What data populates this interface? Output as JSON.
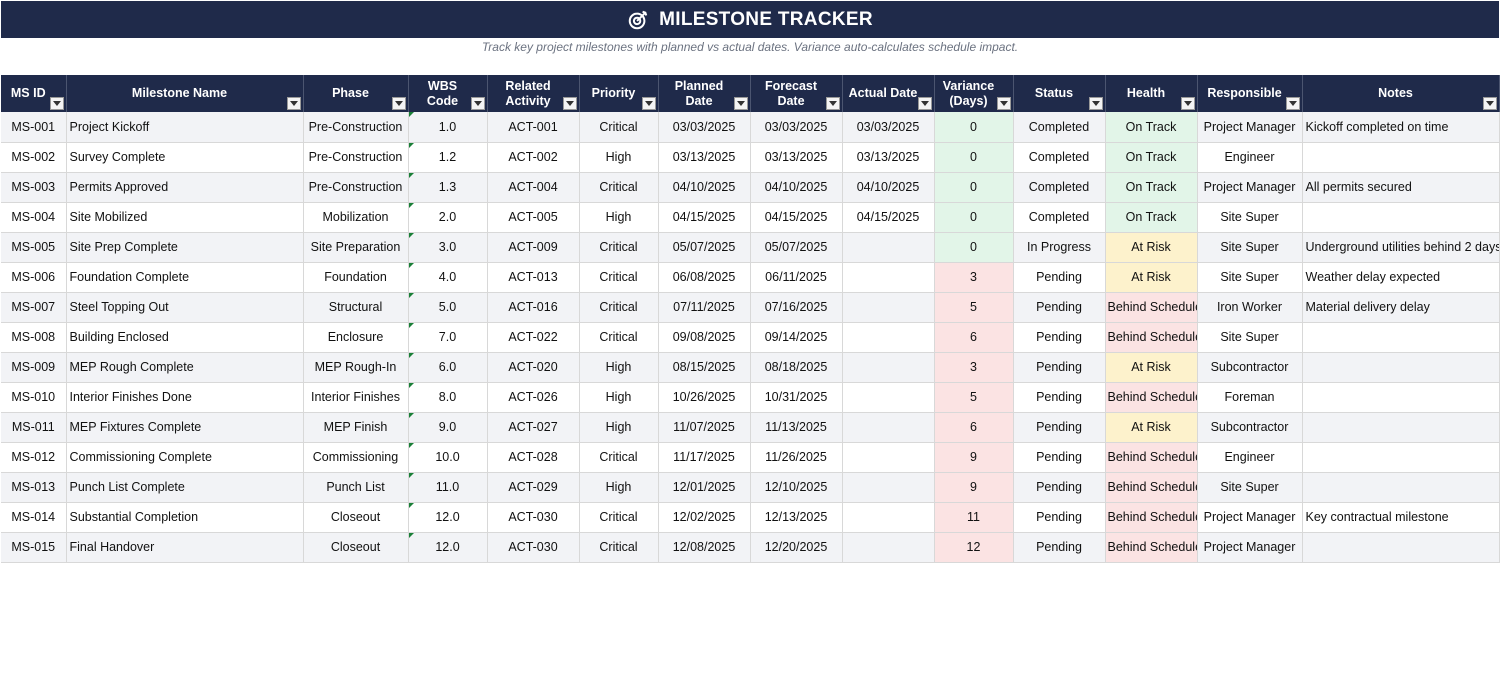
{
  "header": {
    "title": "MILESTONE TRACKER",
    "subtitle": "Track key project milestones with planned vs actual dates. Variance auto-calculates schedule impact.",
    "icon": "target-icon",
    "color": "#1f2a4a"
  },
  "columns": [
    "MS ID",
    "Milestone Name",
    "Phase",
    "WBS Code",
    "Related Activity",
    "Priority",
    "Planned Date",
    "Forecast Date",
    "Actual Date",
    "Variance (Days)",
    "Status",
    "Health",
    "Responsible",
    "Notes"
  ],
  "colors": {
    "green": "#e2f5e8",
    "yellow": "#fdf2cc",
    "red": "#fbe3e3"
  },
  "rows": [
    {
      "id": "MS-001",
      "name": "Project Kickoff",
      "phase": "Pre-Construction",
      "wbs": "1.0",
      "activity": "ACT-001",
      "priority": "Critical",
      "planned": "03/03/2025",
      "forecast": "03/03/2025",
      "actual": "03/03/2025",
      "variance": "0",
      "status": "Completed",
      "health": "On Track",
      "responsible": "Project Manager",
      "notes": "Kickoff completed on time"
    },
    {
      "id": "MS-002",
      "name": "Survey Complete",
      "phase": "Pre-Construction",
      "wbs": "1.2",
      "activity": "ACT-002",
      "priority": "High",
      "planned": "03/13/2025",
      "forecast": "03/13/2025",
      "actual": "03/13/2025",
      "variance": "0",
      "status": "Completed",
      "health": "On Track",
      "responsible": "Engineer",
      "notes": ""
    },
    {
      "id": "MS-003",
      "name": "Permits Approved",
      "phase": "Pre-Construction",
      "wbs": "1.3",
      "activity": "ACT-004",
      "priority": "Critical",
      "planned": "04/10/2025",
      "forecast": "04/10/2025",
      "actual": "04/10/2025",
      "variance": "0",
      "status": "Completed",
      "health": "On Track",
      "responsible": "Project Manager",
      "notes": "All permits secured"
    },
    {
      "id": "MS-004",
      "name": "Site Mobilized",
      "phase": "Mobilization",
      "wbs": "2.0",
      "activity": "ACT-005",
      "priority": "High",
      "planned": "04/15/2025",
      "forecast": "04/15/2025",
      "actual": "04/15/2025",
      "variance": "0",
      "status": "Completed",
      "health": "On Track",
      "responsible": "Site Super",
      "notes": ""
    },
    {
      "id": "MS-005",
      "name": "Site Prep Complete",
      "phase": "Site Preparation",
      "wbs": "3.0",
      "activity": "ACT-009",
      "priority": "Critical",
      "planned": "05/07/2025",
      "forecast": "05/07/2025",
      "actual": "",
      "variance": "0",
      "status": "In Progress",
      "health": "At Risk",
      "responsible": "Site Super",
      "notes": "Underground utilities behind 2 days"
    },
    {
      "id": "MS-006",
      "name": "Foundation Complete",
      "phase": "Foundation",
      "wbs": "4.0",
      "activity": "ACT-013",
      "priority": "Critical",
      "planned": "06/08/2025",
      "forecast": "06/11/2025",
      "actual": "",
      "variance": "3",
      "status": "Pending",
      "health": "At Risk",
      "responsible": "Site Super",
      "notes": "Weather delay expected"
    },
    {
      "id": "MS-007",
      "name": "Steel Topping Out",
      "phase": "Structural",
      "wbs": "5.0",
      "activity": "ACT-016",
      "priority": "Critical",
      "planned": "07/11/2025",
      "forecast": "07/16/2025",
      "actual": "",
      "variance": "5",
      "status": "Pending",
      "health": "Behind Schedule",
      "responsible": "Iron Worker",
      "notes": "Material delivery delay"
    },
    {
      "id": "MS-008",
      "name": "Building Enclosed",
      "phase": "Enclosure",
      "wbs": "7.0",
      "activity": "ACT-022",
      "priority": "Critical",
      "planned": "09/08/2025",
      "forecast": "09/14/2025",
      "actual": "",
      "variance": "6",
      "status": "Pending",
      "health": "Behind Schedule",
      "responsible": "Site Super",
      "notes": ""
    },
    {
      "id": "MS-009",
      "name": "MEP Rough Complete",
      "phase": "MEP Rough-In",
      "wbs": "6.0",
      "activity": "ACT-020",
      "priority": "High",
      "planned": "08/15/2025",
      "forecast": "08/18/2025",
      "actual": "",
      "variance": "3",
      "status": "Pending",
      "health": "At Risk",
      "responsible": "Subcontractor",
      "notes": ""
    },
    {
      "id": "MS-010",
      "name": "Interior Finishes Done",
      "phase": "Interior Finishes",
      "wbs": "8.0",
      "activity": "ACT-026",
      "priority": "High",
      "planned": "10/26/2025",
      "forecast": "10/31/2025",
      "actual": "",
      "variance": "5",
      "status": "Pending",
      "health": "Behind Schedule",
      "responsible": "Foreman",
      "notes": ""
    },
    {
      "id": "MS-011",
      "name": "MEP Fixtures Complete",
      "phase": "MEP Finish",
      "wbs": "9.0",
      "activity": "ACT-027",
      "priority": "High",
      "planned": "11/07/2025",
      "forecast": "11/13/2025",
      "actual": "",
      "variance": "6",
      "status": "Pending",
      "health": "At Risk",
      "responsible": "Subcontractor",
      "notes": ""
    },
    {
      "id": "MS-012",
      "name": "Commissioning Complete",
      "phase": "Commissioning",
      "wbs": "10.0",
      "activity": "ACT-028",
      "priority": "Critical",
      "planned": "11/17/2025",
      "forecast": "11/26/2025",
      "actual": "",
      "variance": "9",
      "status": "Pending",
      "health": "Behind Schedule",
      "responsible": "Engineer",
      "notes": ""
    },
    {
      "id": "MS-013",
      "name": "Punch List Complete",
      "phase": "Punch List",
      "wbs": "11.0",
      "activity": "ACT-029",
      "priority": "High",
      "planned": "12/01/2025",
      "forecast": "12/10/2025",
      "actual": "",
      "variance": "9",
      "status": "Pending",
      "health": "Behind Schedule",
      "responsible": "Site Super",
      "notes": ""
    },
    {
      "id": "MS-014",
      "name": "Substantial Completion",
      "phase": "Closeout",
      "wbs": "12.0",
      "activity": "ACT-030",
      "priority": "Critical",
      "planned": "12/02/2025",
      "forecast": "12/13/2025",
      "actual": "",
      "variance": "11",
      "status": "Pending",
      "health": "Behind Schedule",
      "responsible": "Project Manager",
      "notes": "Key contractual milestone"
    },
    {
      "id": "MS-015",
      "name": "Final Handover",
      "phase": "Closeout",
      "wbs": "12.0",
      "activity": "ACT-030",
      "priority": "Critical",
      "planned": "12/08/2025",
      "forecast": "12/20/2025",
      "actual": "",
      "variance": "12",
      "status": "Pending",
      "health": "Behind Schedule",
      "responsible": "Project Manager",
      "notes": ""
    }
  ]
}
